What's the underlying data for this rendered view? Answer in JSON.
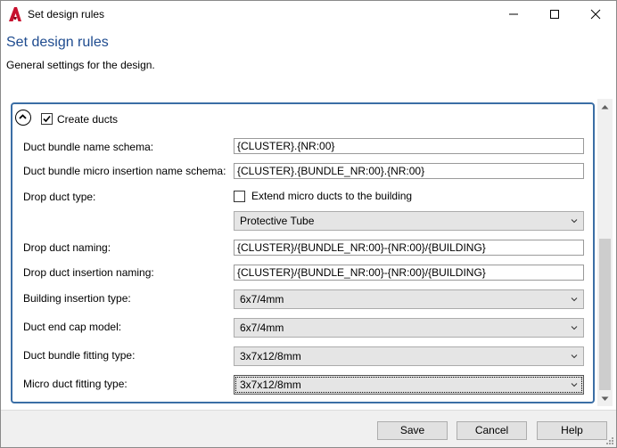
{
  "window": {
    "title": "Set design rules",
    "app_icon": "autocad-a-icon"
  },
  "header": {
    "title": "Set design rules",
    "subtitle": "General settings for the design."
  },
  "group": {
    "label": "Create ducts",
    "checked": true,
    "collapse_icon": "chevron-up-circle-icon"
  },
  "rows": {
    "bundle_name_schema": {
      "label": "Duct bundle name schema:",
      "value": "{CLUSTER}.{NR:00}"
    },
    "micro_insertion_schema": {
      "label": "Duct bundle micro insertion name schema:",
      "value": "{CLUSTER}.{BUNDLE_NR:00}.{NR:00}"
    },
    "drop_duct_type": {
      "label": "Drop duct type:",
      "extend_label": "Extend micro ducts to the building",
      "extend_checked": false,
      "selected": "Protective Tube"
    },
    "drop_duct_naming": {
      "label": "Drop duct naming:",
      "value": "{CLUSTER}/{BUNDLE_NR:00}-{NR:00}/{BUILDING}"
    },
    "drop_duct_insertion_naming": {
      "label": "Drop duct insertion naming:",
      "value": "{CLUSTER}/{BUNDLE_NR:00}-{NR:00}/{BUILDING}"
    },
    "building_insertion_type": {
      "label": "Building insertion type:",
      "selected": "6x7/4mm"
    },
    "duct_end_cap_model": {
      "label": "Duct end cap model:",
      "selected": "6x7/4mm"
    },
    "duct_bundle_fitting_type": {
      "label": "Duct bundle fitting type:",
      "selected": "3x7x12/8mm"
    },
    "micro_duct_fitting_type": {
      "label": "Micro duct fitting type:",
      "selected": "3x7x12/8mm"
    }
  },
  "footer": {
    "save": "Save",
    "cancel": "Cancel",
    "help": "Help"
  },
  "colors": {
    "header_title": "#1e4b8f",
    "group_border": "#3b6ea5",
    "app_icon_red": "#c8102e"
  }
}
